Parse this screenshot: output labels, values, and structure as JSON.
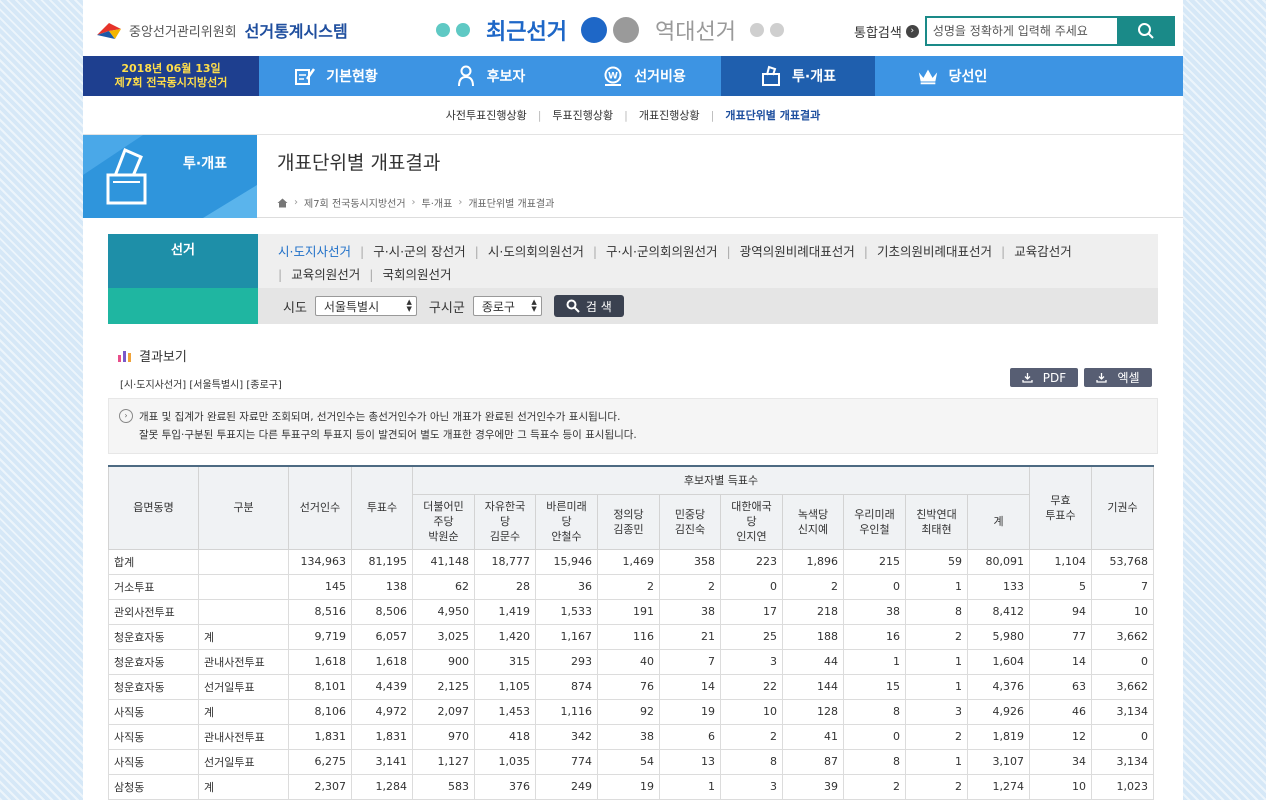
{
  "header": {
    "org": "중앙선거관리위원회",
    "system": "선거통계시스템",
    "tab_recent": "최근선거",
    "tab_past": "역대선거",
    "search_label": "통합검색",
    "search_placeholder": "성명을 정확하게 입력해 주세요"
  },
  "nav": {
    "election_date": "2018년 06월 13일",
    "election_name": "제7회 전국동시지방선거",
    "items": [
      {
        "label": "기본현황"
      },
      {
        "label": "후보자"
      },
      {
        "label": "선거비용"
      },
      {
        "label": "투·개표"
      },
      {
        "label": "당선인"
      }
    ]
  },
  "subnav": [
    "사전투표진행상황",
    "투표진행상황",
    "개표진행상황",
    "개표단위별 개표결과"
  ],
  "section": {
    "label": "투·개표",
    "title": "개표단위별 개표결과",
    "breadcrumb": [
      "제7회 전국동시지방선거",
      "투·개표",
      "개표단위별 개표결과"
    ]
  },
  "filter": {
    "left_label": "선거",
    "elections_row1": [
      "시·도지사선거",
      "구·시·군의 장선거",
      "시·도의회의원선거",
      "구·시·군의회의원선거",
      "광역의원비례대표선거",
      "기초의원비례대표선거",
      "교육감선거"
    ],
    "elections_row2": [
      "교육의원선거",
      "국회의원선거"
    ],
    "sido_label": "시도",
    "sido_value": "서울특별시",
    "sigungu_label": "구시군",
    "sigungu_value": "종로구",
    "search_button": "검 색"
  },
  "results": {
    "title": "결과보기",
    "subtitle": "[시·도지사선거] [서울특별시] [종로구]",
    "pdf_button": "PDF",
    "excel_button": "엑셀",
    "notice_1": "개표 및 집계가 완료된 자료만 조회되며, 선거인수는 총선거인수가 아닌 개표가 완료된 선거인수가 표시됩니다.",
    "notice_2": "잘못 투입·구분된 투표지는 다른 투표구의 투표지 등이 발견되어 별도 개표한 경우에만 그 득표수 등이 표시됩니다."
  },
  "table": {
    "headers": {
      "region": "읍면동명",
      "type": "구분",
      "electors": "선거인수",
      "voters": "투표수",
      "candidate_group": "후보자별 득표수",
      "invalid": "무효\n투표수",
      "abstain": "기권수"
    },
    "candidates": [
      "더불어민\n주당\n박원순",
      "자유한국\n당\n김문수",
      "바른미래\n당\n안철수",
      "정의당\n김종민",
      "민중당\n김진숙",
      "대한애국\n당\n인지연",
      "녹색당\n신지예",
      "우리미래\n우인철",
      "친박연대\n최태현",
      "계"
    ],
    "rows": [
      {
        "cells": [
          "합계",
          "",
          "134,963",
          "81,195",
          "41,148",
          "18,777",
          "15,946",
          "1,469",
          "358",
          "223",
          "1,896",
          "215",
          "59",
          "80,091",
          "1,104",
          "53,768"
        ]
      },
      {
        "cells": [
          "거소투표",
          "",
          "145",
          "138",
          "62",
          "28",
          "36",
          "2",
          "2",
          "0",
          "2",
          "0",
          "1",
          "133",
          "5",
          "7"
        ]
      },
      {
        "cells": [
          "관외사전투표",
          "",
          "8,516",
          "8,506",
          "4,950",
          "1,419",
          "1,533",
          "191",
          "38",
          "17",
          "218",
          "38",
          "8",
          "8,412",
          "94",
          "10"
        ]
      },
      {
        "cells": [
          "청운효자동",
          "계",
          "9,719",
          "6,057",
          "3,025",
          "1,420",
          "1,167",
          "116",
          "21",
          "25",
          "188",
          "16",
          "2",
          "5,980",
          "77",
          "3,662"
        ]
      },
      {
        "cells": [
          "청운효자동",
          "관내사전투표",
          "1,618",
          "1,618",
          "900",
          "315",
          "293",
          "40",
          "7",
          "3",
          "44",
          "1",
          "1",
          "1,604",
          "14",
          "0"
        ]
      },
      {
        "cells": [
          "청운효자동",
          "선거일투표",
          "8,101",
          "4,439",
          "2,125",
          "1,105",
          "874",
          "76",
          "14",
          "22",
          "144",
          "15",
          "1",
          "4,376",
          "63",
          "3,662"
        ]
      },
      {
        "cells": [
          "사직동",
          "계",
          "8,106",
          "4,972",
          "2,097",
          "1,453",
          "1,116",
          "92",
          "19",
          "10",
          "128",
          "8",
          "3",
          "4,926",
          "46",
          "3,134"
        ]
      },
      {
        "cells": [
          "사직동",
          "관내사전투표",
          "1,831",
          "1,831",
          "970",
          "418",
          "342",
          "38",
          "6",
          "2",
          "41",
          "0",
          "2",
          "1,819",
          "12",
          "0"
        ]
      },
      {
        "cells": [
          "사직동",
          "선거일투표",
          "6,275",
          "3,141",
          "1,127",
          "1,035",
          "774",
          "54",
          "13",
          "8",
          "87",
          "8",
          "1",
          "3,107",
          "34",
          "3,134"
        ]
      },
      {
        "cells": [
          "삼청동",
          "계",
          "2,307",
          "1,284",
          "583",
          "376",
          "249",
          "19",
          "1",
          "3",
          "39",
          "2",
          "2",
          "1,274",
          "10",
          "1,023"
        ]
      }
    ]
  },
  "colors": {
    "nav_blue": "#3d94e3",
    "nav_active": "#1f5fae",
    "accent_teal": "#1a8a88",
    "election_badge": "#1e3f8f"
  }
}
